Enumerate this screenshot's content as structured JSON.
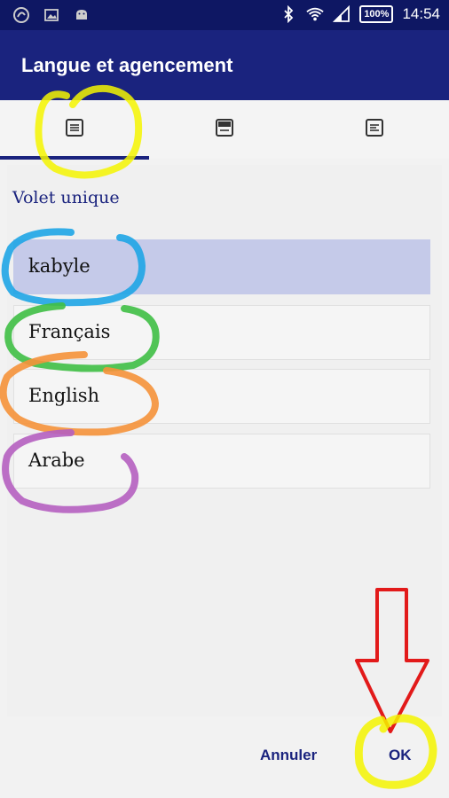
{
  "status_bar": {
    "time": "14:54",
    "battery": "100%",
    "left_icons": [
      "app-logo-icon",
      "image-icon",
      "android-icon"
    ],
    "right_icons": [
      "bluetooth-icon",
      "wifi-icon",
      "signal-icon"
    ]
  },
  "app_bar": {
    "title": "Langue et agencement"
  },
  "tabs": [
    {
      "icon": "single-pane-icon",
      "selected": true
    },
    {
      "icon": "split-pane-icon",
      "selected": false
    },
    {
      "icon": "text-pane-icon",
      "selected": false
    }
  ],
  "section": {
    "title": "Volet unique"
  },
  "languages": [
    {
      "label": "kabyle",
      "selected": true
    },
    {
      "label": "Français",
      "selected": false
    },
    {
      "label": "English",
      "selected": false
    },
    {
      "label": "Arabe",
      "selected": false
    }
  ],
  "footer": {
    "cancel_label": "Annuler",
    "ok_label": "OK"
  },
  "colors": {
    "status_bar": "#0e1763",
    "app_bar": "#1a237e",
    "accent": "#1a237e",
    "selected_item": "#c5cae9",
    "annotation_yellow": "#f5f500",
    "annotation_blue": "#1ea5e6",
    "annotation_green": "#3fbf45",
    "annotation_orange": "#f5923a",
    "annotation_purple": "#b55fc0",
    "annotation_red": "#e21a1a"
  }
}
